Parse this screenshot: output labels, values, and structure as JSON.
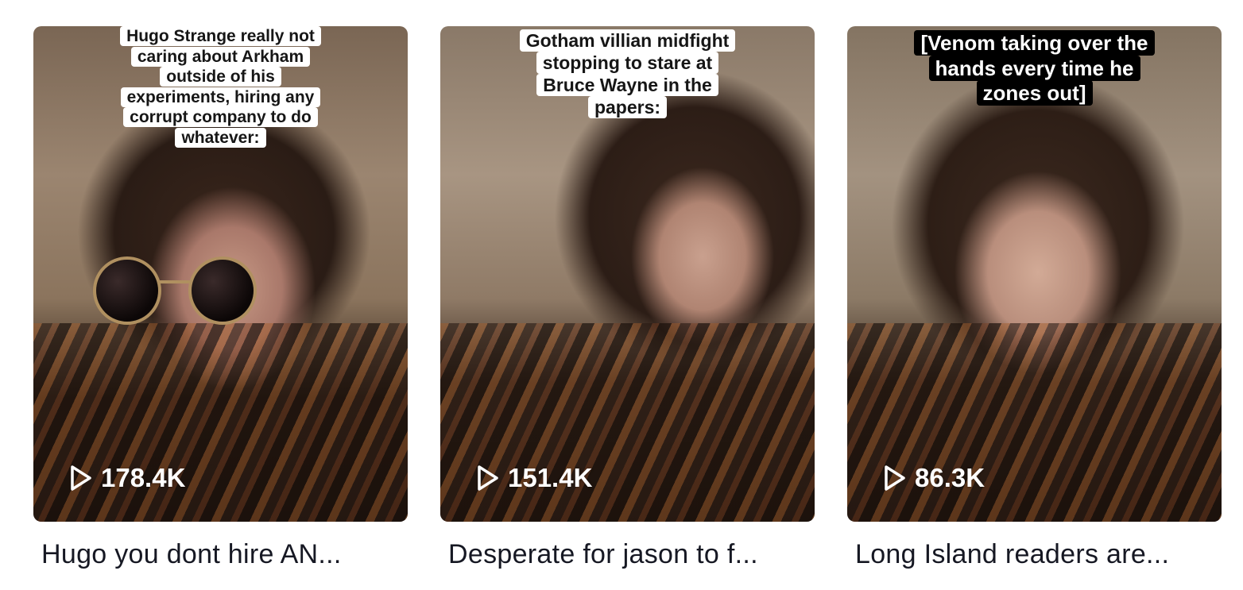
{
  "videos": [
    {
      "caption": [
        "Hugo Strange really not",
        "caring about Arkham",
        "outside of his",
        "experiments, hiring any",
        "corrupt company to do",
        "whatever:"
      ],
      "caption_style": "light",
      "views": "178.4K",
      "title": "Hugo you dont hire AN..."
    },
    {
      "caption": [
        "Gotham villian midfight",
        "stopping to stare at",
        "Bruce Wayne in the",
        "papers:"
      ],
      "caption_style": "light",
      "views": "151.4K",
      "title": "Desperate for jason to f..."
    },
    {
      "caption": [
        "[Venom taking over the",
        "hands every time he",
        "zones out]"
      ],
      "caption_style": "dark",
      "views": "86.3K",
      "title": "Long Island readers are..."
    }
  ],
  "icons": {
    "views": "play-outline-icon"
  },
  "colors": {
    "title_text": "#161823",
    "caption_light_bg": "#ffffff",
    "caption_dark_bg": "#000000",
    "views_text": "#ffffff"
  }
}
